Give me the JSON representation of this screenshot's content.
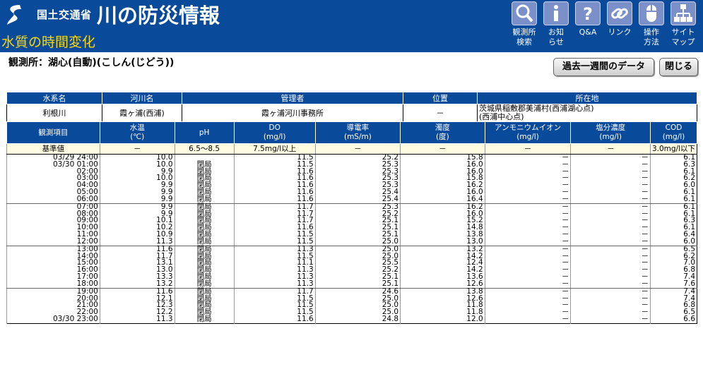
{
  "header": {
    "brand": "国土交通省",
    "site_title": "川の防災情報",
    "page_title": "水質の時間変化",
    "nav": [
      {
        "icon": "search-icon",
        "label": "観測所\n検索"
      },
      {
        "icon": "info-icon",
        "label": "お知\nらせ"
      },
      {
        "icon": "question-icon",
        "label": "Q&A"
      },
      {
        "icon": "link-icon",
        "label": "リンク"
      },
      {
        "icon": "mouse-icon",
        "label": "操作\n方法"
      },
      {
        "icon": "sitemap-icon",
        "label": "サイト\nマップ"
      }
    ]
  },
  "station_label": "観測所：湖心(自動)(こしん(じどう))",
  "buttons": {
    "week": "過去一週間のデータ",
    "close": "閉じる"
  },
  "info": {
    "headers": [
      "水系名",
      "河川名",
      "管理者",
      "位置",
      "所在地"
    ],
    "values": [
      "利根川",
      "霞ヶ浦(西浦)",
      "霞ヶ浦河川事務所",
      "－",
      "茨城県稲敷郡美浦村(西浦湖心点)\n(西浦中心点)"
    ]
  },
  "table": {
    "headers": [
      "観測項目",
      "水温\n(℃)",
      "pH",
      "DO\n(mg/l)",
      "導電率\n(mS/m)",
      "濁度\n(度)",
      "アンモニウムイオン\n(mg/l)",
      "塩分濃度\n(mg/l)",
      "COD\n(mg/l)"
    ],
    "standard": [
      "基準値",
      "－",
      "6.5～8.5",
      "7.5mg/l以上",
      "－",
      "－",
      "－",
      "－",
      "3.0mg/l以下"
    ],
    "rows": [
      [
        "03/29 24:00",
        "10.0",
        "",
        "11.5",
        "25.2",
        "15.8",
        "－",
        "－",
        "6.1"
      ],
      [
        "03/30 01:00",
        "10.0",
        "閉局",
        "11.5",
        "25.3",
        "16.0",
        "－",
        "－",
        "6.3"
      ],
      [
        "02:00",
        "9.9",
        "閉局",
        "11.6",
        "25.3",
        "16.0",
        "－",
        "－",
        "6.1"
      ],
      [
        "03:00",
        "10.0",
        "閉局",
        "11.6",
        "25.3",
        "15.8",
        "－",
        "－",
        "6.2"
      ],
      [
        "04:00",
        "9.9",
        "閉局",
        "11.6",
        "25.3",
        "16.2",
        "－",
        "－",
        "6.0"
      ],
      [
        "05:00",
        "9.9",
        "閉局",
        "11.6",
        "25.4",
        "16.0",
        "－",
        "－",
        "6.1"
      ],
      [
        "06:00",
        "9.9",
        "閉局",
        "11.6",
        "25.4",
        "16.4",
        "－",
        "－",
        "6.1"
      ],
      [
        "07:00",
        "9.9",
        "閉局",
        "11.7",
        "25.3",
        "16.2",
        "－",
        "－",
        "6.1"
      ],
      [
        "08:00",
        "9.9",
        "閉局",
        "11.7",
        "25.2",
        "16.0",
        "－",
        "－",
        "6.1"
      ],
      [
        "09:00",
        "10.1",
        "閉局",
        "11.7",
        "25.1",
        "15.2",
        "－",
        "－",
        "6.3"
      ],
      [
        "10:00",
        "10.2",
        "閉局",
        "11.6",
        "25.1",
        "14.8",
        "－",
        "－",
        "6.1"
      ],
      [
        "11:00",
        "10.9",
        "閉局",
        "11.5",
        "25.1",
        "13.8",
        "－",
        "－",
        "6.4"
      ],
      [
        "12:00",
        "11.3",
        "閉局",
        "11.5",
        "25.0",
        "13.0",
        "－",
        "－",
        "6.0"
      ],
      [
        "13:00",
        "11.6",
        "閉局",
        "11.3",
        "25.0",
        "13.2",
        "－",
        "－",
        "6.5"
      ],
      [
        "14:00",
        "11.7",
        "閉局",
        "11.5",
        "25.0",
        "14.2",
        "－",
        "－",
        "6.2"
      ],
      [
        "15:00",
        "13.1",
        "閉局",
        "11.1",
        "25.5",
        "12.4",
        "－",
        "－",
        "7.0"
      ],
      [
        "16:00",
        "13.0",
        "閉局",
        "11.3",
        "25.2",
        "14.2",
        "－",
        "－",
        "6.8"
      ],
      [
        "17:00",
        "13.3",
        "閉局",
        "11.3",
        "25.1",
        "13.6",
        "－",
        "－",
        "7.4"
      ],
      [
        "18:00",
        "13.2",
        "閉局",
        "11.3",
        "25.1",
        "12.6",
        "－",
        "－",
        "7.6"
      ],
      [
        "19:00",
        "11.6",
        "閉局",
        "11.7",
        "24.6",
        "13.8",
        "－",
        "－",
        "7.4"
      ],
      [
        "20:00",
        "12.1",
        "閉局",
        "11.5",
        "25.0",
        "12.6",
        "－",
        "－",
        "7.4"
      ],
      [
        "21:00",
        "12.3",
        "閉局",
        "11.5",
        "25.0",
        "11.8",
        "－",
        "－",
        "6.8"
      ],
      [
        "22:00",
        "12.2",
        "閉局",
        "11.5",
        "25.0",
        "11.8",
        "－",
        "－",
        "6.5"
      ],
      [
        "03/30 23:00",
        "11.3",
        "閉局",
        "11.6",
        "24.8",
        "12.0",
        "－",
        "－",
        "6.6"
      ]
    ]
  }
}
